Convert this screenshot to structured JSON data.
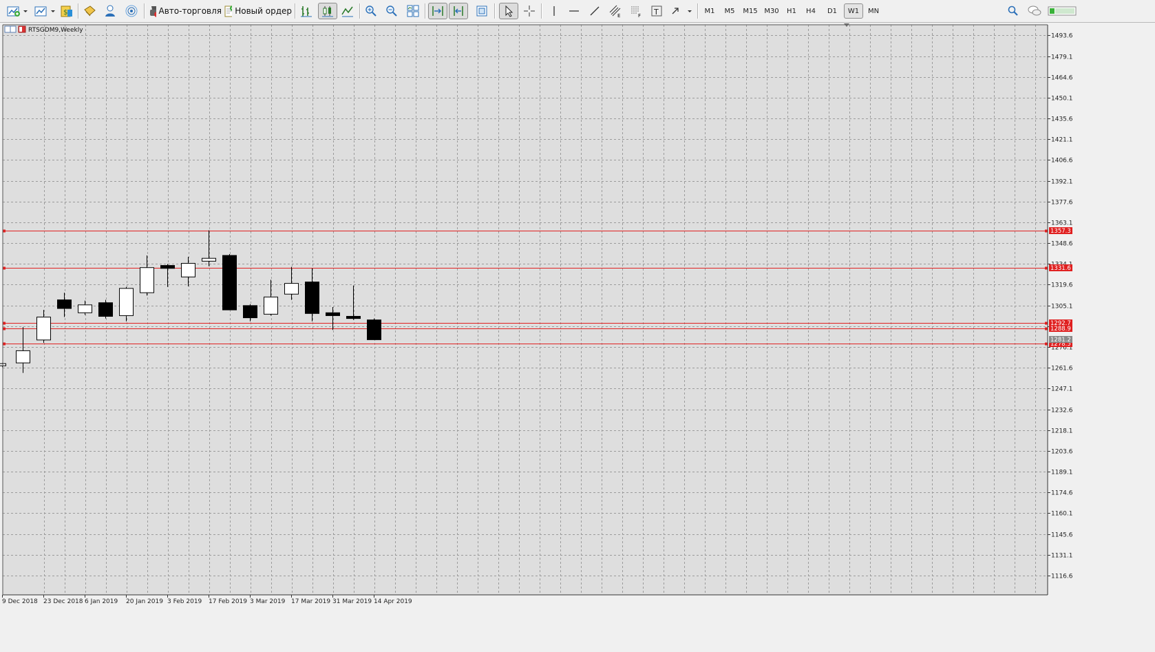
{
  "toolbar": {
    "auto_trading_label": "Авто-торговля",
    "new_order_label": "Новый ордер",
    "timeframes": [
      "M1",
      "M5",
      "M15",
      "M30",
      "H1",
      "H4",
      "D1",
      "W1",
      "MN"
    ],
    "active_timeframe": "W1"
  },
  "chart_window": {
    "title": "RTSGDM9,Weekly"
  },
  "chart_data": {
    "type": "candlestick",
    "symbol": "RTSGDM9",
    "period": "Weekly",
    "ylim": [
      1103.1,
      1501.0
    ],
    "y_ticks": [
      "1493.6",
      "1479.1",
      "1464.6",
      "1450.1",
      "1435.6",
      "1421.1",
      "1406.6",
      "1392.1",
      "1377.6",
      "1363.1",
      "1348.6",
      "1334.1",
      "1319.6",
      "1305.1",
      "1290.6",
      "1276.1",
      "1261.6",
      "1247.1",
      "1232.6",
      "1218.1",
      "1203.6",
      "1189.1",
      "1174.6",
      "1160.1",
      "1145.6",
      "1131.1",
      "1116.6"
    ],
    "x_labels": [
      "9 Dec 2018",
      "23 Dec 2018",
      "6 Jan 2019",
      "20 Jan 2019",
      "3 Feb 2019",
      "17 Feb 2019",
      "3 Mar 2019",
      "17 Mar 2019",
      "31 Mar 2019",
      "14 Apr 2019"
    ],
    "candles": [
      {
        "date": "9 Dec 2018",
        "open": 1263.0,
        "high": 1265.0,
        "low": 1262.0,
        "close": 1264.5
      },
      {
        "date": "16 Dec 2018",
        "open": 1265.0,
        "high": 1290.0,
        "low": 1258.0,
        "close": 1273.5
      },
      {
        "date": "23 Dec 2018",
        "open": 1281.0,
        "high": 1302.0,
        "low": 1279.0,
        "close": 1297.0
      },
      {
        "date": "30 Dec 2018",
        "open": 1309.0,
        "high": 1314.0,
        "low": 1297.0,
        "close": 1303.0
      },
      {
        "date": "6 Jan 2019",
        "open": 1300.0,
        "high": 1308.5,
        "low": 1298.5,
        "close": 1305.5
      },
      {
        "date": "13 Jan 2019",
        "open": 1307.0,
        "high": 1309.0,
        "low": 1296.0,
        "close": 1297.5
      },
      {
        "date": "20 Jan 2019",
        "open": 1298.0,
        "high": 1318.0,
        "low": 1294.0,
        "close": 1317.0
      },
      {
        "date": "27 Jan 2019",
        "open": 1314.0,
        "high": 1340.0,
        "low": 1312.0,
        "close": 1331.5
      },
      {
        "date": "3 Feb 2019",
        "open": 1333.0,
        "high": 1334.0,
        "low": 1318.0,
        "close": 1331.0
      },
      {
        "date": "10 Feb 2019",
        "open": 1325.0,
        "high": 1339.0,
        "low": 1318.5,
        "close": 1334.5
      },
      {
        "date": "17 Feb 2019",
        "open": 1336.0,
        "high": 1357.5,
        "low": 1332.5,
        "close": 1338.0
      },
      {
        "date": "24 Feb 2019",
        "open": 1340.0,
        "high": 1341.0,
        "low": 1302.0,
        "close": 1302.0
      },
      {
        "date": "3 Mar 2019",
        "open": 1305.0,
        "high": 1306.0,
        "low": 1294.0,
        "close": 1296.5
      },
      {
        "date": "10 Mar 2019",
        "open": 1299.0,
        "high": 1323.0,
        "low": 1298.0,
        "close": 1311.0
      },
      {
        "date": "17 Mar 2019",
        "open": 1313.0,
        "high": 1332.0,
        "low": 1309.0,
        "close": 1320.5
      },
      {
        "date": "24 Mar 2019",
        "open": 1321.5,
        "high": 1331.0,
        "low": 1294.0,
        "close": 1299.5
      },
      {
        "date": "31 Mar 2019",
        "open": 1300.0,
        "high": 1304.0,
        "low": 1288.0,
        "close": 1298.0
      },
      {
        "date": "7 Apr 2019",
        "open": 1297.5,
        "high": 1319.0,
        "low": 1295.0,
        "close": 1296.0
      },
      {
        "date": "14 Apr 2019",
        "open": 1295.0,
        "high": 1296.0,
        "low": 1281.2,
        "close": 1281.2
      }
    ],
    "horizontal_lines": [
      {
        "price": 1357.3,
        "label": "1357.3"
      },
      {
        "price": 1331.6,
        "label": "1331.6"
      },
      {
        "price": 1292.7,
        "label": "1292.7"
      },
      {
        "price": 1288.9,
        "label": "1288.9"
      },
      {
        "price": 1278.5,
        "label": "1278.5"
      }
    ],
    "current_price": {
      "price": 1281.2,
      "label": "1281.2"
    },
    "grid": true,
    "colors": {
      "background": "#dedede",
      "grid": "#9a9a9a",
      "bull_candle": "#ffffff",
      "bear_candle": "#000000",
      "level_line": "#e02020",
      "current_price_tag": "#8a8a8a"
    }
  }
}
